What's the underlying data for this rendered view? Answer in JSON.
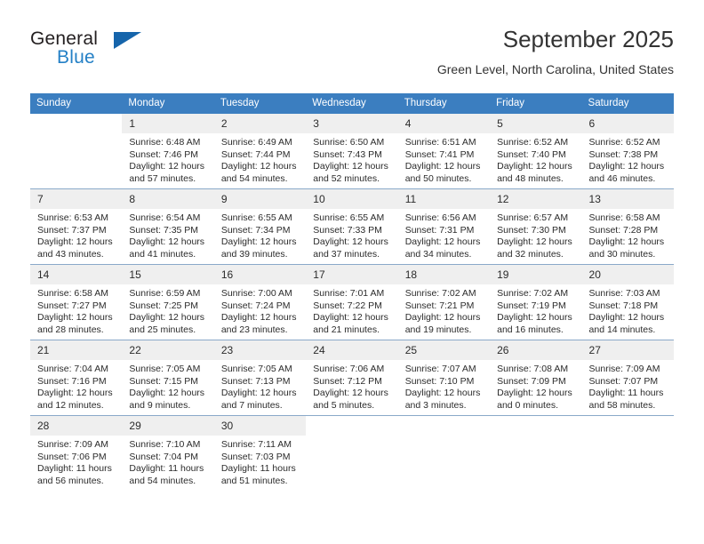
{
  "logo": {
    "word_one": "General",
    "word_two": "Blue",
    "triangle_color": "#1665ab",
    "blue_color": "#2480c6"
  },
  "header": {
    "title": "September 2025",
    "subtitle": "Green Level, North Carolina, United States",
    "header_bg": "#3b7ec0"
  },
  "calendar": {
    "weekday_headers": [
      "Sunday",
      "Monday",
      "Tuesday",
      "Wednesday",
      "Thursday",
      "Friday",
      "Saturday"
    ],
    "weeks": [
      [
        {
          "day": ""
        },
        {
          "day": "1",
          "sunrise": "Sunrise: 6:48 AM",
          "sunset": "Sunset: 7:46 PM",
          "daylight_1": "Daylight: 12 hours",
          "daylight_2": "and 57 minutes."
        },
        {
          "day": "2",
          "sunrise": "Sunrise: 6:49 AM",
          "sunset": "Sunset: 7:44 PM",
          "daylight_1": "Daylight: 12 hours",
          "daylight_2": "and 54 minutes."
        },
        {
          "day": "3",
          "sunrise": "Sunrise: 6:50 AM",
          "sunset": "Sunset: 7:43 PM",
          "daylight_1": "Daylight: 12 hours",
          "daylight_2": "and 52 minutes."
        },
        {
          "day": "4",
          "sunrise": "Sunrise: 6:51 AM",
          "sunset": "Sunset: 7:41 PM",
          "daylight_1": "Daylight: 12 hours",
          "daylight_2": "and 50 minutes."
        },
        {
          "day": "5",
          "sunrise": "Sunrise: 6:52 AM",
          "sunset": "Sunset: 7:40 PM",
          "daylight_1": "Daylight: 12 hours",
          "daylight_2": "and 48 minutes."
        },
        {
          "day": "6",
          "sunrise": "Sunrise: 6:52 AM",
          "sunset": "Sunset: 7:38 PM",
          "daylight_1": "Daylight: 12 hours",
          "daylight_2": "and 46 minutes."
        }
      ],
      [
        {
          "day": "7",
          "sunrise": "Sunrise: 6:53 AM",
          "sunset": "Sunset: 7:37 PM",
          "daylight_1": "Daylight: 12 hours",
          "daylight_2": "and 43 minutes."
        },
        {
          "day": "8",
          "sunrise": "Sunrise: 6:54 AM",
          "sunset": "Sunset: 7:35 PM",
          "daylight_1": "Daylight: 12 hours",
          "daylight_2": "and 41 minutes."
        },
        {
          "day": "9",
          "sunrise": "Sunrise: 6:55 AM",
          "sunset": "Sunset: 7:34 PM",
          "daylight_1": "Daylight: 12 hours",
          "daylight_2": "and 39 minutes."
        },
        {
          "day": "10",
          "sunrise": "Sunrise: 6:55 AM",
          "sunset": "Sunset: 7:33 PM",
          "daylight_1": "Daylight: 12 hours",
          "daylight_2": "and 37 minutes."
        },
        {
          "day": "11",
          "sunrise": "Sunrise: 6:56 AM",
          "sunset": "Sunset: 7:31 PM",
          "daylight_1": "Daylight: 12 hours",
          "daylight_2": "and 34 minutes."
        },
        {
          "day": "12",
          "sunrise": "Sunrise: 6:57 AM",
          "sunset": "Sunset: 7:30 PM",
          "daylight_1": "Daylight: 12 hours",
          "daylight_2": "and 32 minutes."
        },
        {
          "day": "13",
          "sunrise": "Sunrise: 6:58 AM",
          "sunset": "Sunset: 7:28 PM",
          "daylight_1": "Daylight: 12 hours",
          "daylight_2": "and 30 minutes."
        }
      ],
      [
        {
          "day": "14",
          "sunrise": "Sunrise: 6:58 AM",
          "sunset": "Sunset: 7:27 PM",
          "daylight_1": "Daylight: 12 hours",
          "daylight_2": "and 28 minutes."
        },
        {
          "day": "15",
          "sunrise": "Sunrise: 6:59 AM",
          "sunset": "Sunset: 7:25 PM",
          "daylight_1": "Daylight: 12 hours",
          "daylight_2": "and 25 minutes."
        },
        {
          "day": "16",
          "sunrise": "Sunrise: 7:00 AM",
          "sunset": "Sunset: 7:24 PM",
          "daylight_1": "Daylight: 12 hours",
          "daylight_2": "and 23 minutes."
        },
        {
          "day": "17",
          "sunrise": "Sunrise: 7:01 AM",
          "sunset": "Sunset: 7:22 PM",
          "daylight_1": "Daylight: 12 hours",
          "daylight_2": "and 21 minutes."
        },
        {
          "day": "18",
          "sunrise": "Sunrise: 7:02 AM",
          "sunset": "Sunset: 7:21 PM",
          "daylight_1": "Daylight: 12 hours",
          "daylight_2": "and 19 minutes."
        },
        {
          "day": "19",
          "sunrise": "Sunrise: 7:02 AM",
          "sunset": "Sunset: 7:19 PM",
          "daylight_1": "Daylight: 12 hours",
          "daylight_2": "and 16 minutes."
        },
        {
          "day": "20",
          "sunrise": "Sunrise: 7:03 AM",
          "sunset": "Sunset: 7:18 PM",
          "daylight_1": "Daylight: 12 hours",
          "daylight_2": "and 14 minutes."
        }
      ],
      [
        {
          "day": "21",
          "sunrise": "Sunrise: 7:04 AM",
          "sunset": "Sunset: 7:16 PM",
          "daylight_1": "Daylight: 12 hours",
          "daylight_2": "and 12 minutes."
        },
        {
          "day": "22",
          "sunrise": "Sunrise: 7:05 AM",
          "sunset": "Sunset: 7:15 PM",
          "daylight_1": "Daylight: 12 hours",
          "daylight_2": "and 9 minutes."
        },
        {
          "day": "23",
          "sunrise": "Sunrise: 7:05 AM",
          "sunset": "Sunset: 7:13 PM",
          "daylight_1": "Daylight: 12 hours",
          "daylight_2": "and 7 minutes."
        },
        {
          "day": "24",
          "sunrise": "Sunrise: 7:06 AM",
          "sunset": "Sunset: 7:12 PM",
          "daylight_1": "Daylight: 12 hours",
          "daylight_2": "and 5 minutes."
        },
        {
          "day": "25",
          "sunrise": "Sunrise: 7:07 AM",
          "sunset": "Sunset: 7:10 PM",
          "daylight_1": "Daylight: 12 hours",
          "daylight_2": "and 3 minutes."
        },
        {
          "day": "26",
          "sunrise": "Sunrise: 7:08 AM",
          "sunset": "Sunset: 7:09 PM",
          "daylight_1": "Daylight: 12 hours",
          "daylight_2": "and 0 minutes."
        },
        {
          "day": "27",
          "sunrise": "Sunrise: 7:09 AM",
          "sunset": "Sunset: 7:07 PM",
          "daylight_1": "Daylight: 11 hours",
          "daylight_2": "and 58 minutes."
        }
      ],
      [
        {
          "day": "28",
          "sunrise": "Sunrise: 7:09 AM",
          "sunset": "Sunset: 7:06 PM",
          "daylight_1": "Daylight: 11 hours",
          "daylight_2": "and 56 minutes."
        },
        {
          "day": "29",
          "sunrise": "Sunrise: 7:10 AM",
          "sunset": "Sunset: 7:04 PM",
          "daylight_1": "Daylight: 11 hours",
          "daylight_2": "and 54 minutes."
        },
        {
          "day": "30",
          "sunrise": "Sunrise: 7:11 AM",
          "sunset": "Sunset: 7:03 PM",
          "daylight_1": "Daylight: 11 hours",
          "daylight_2": "and 51 minutes."
        },
        {
          "day": ""
        },
        {
          "day": ""
        },
        {
          "day": ""
        },
        {
          "day": ""
        }
      ]
    ]
  }
}
